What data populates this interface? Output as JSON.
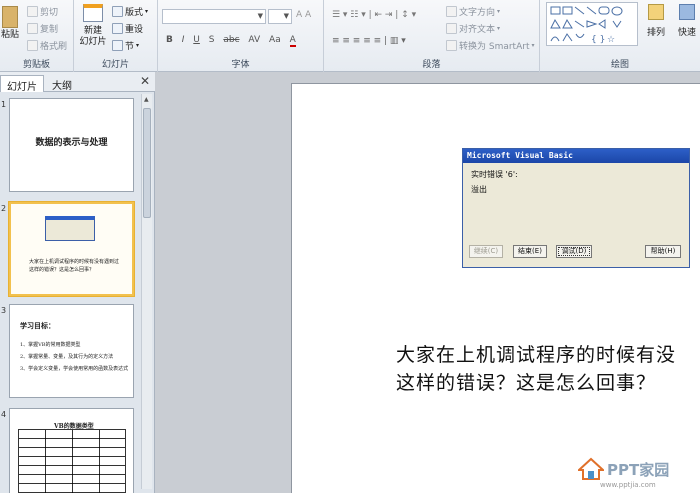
{
  "ribbon": {
    "clipboard": {
      "paste_label": "粘贴",
      "cut_label": "剪切",
      "copy_label": "复制",
      "format_painter_label": "格式刷",
      "group_label": "剪贴板"
    },
    "slides": {
      "new_slide_label": "新建",
      "new_slide_label2": "幻灯片",
      "layout_label": "版式",
      "reset_label": "重设",
      "section_label": "节",
      "group_label": "幻灯片"
    },
    "font": {
      "group_label": "字体",
      "format_buttons": [
        "B",
        "I",
        "U",
        "S",
        "abc",
        "AV",
        "Aa",
        "A"
      ]
    },
    "paragraph": {
      "text_direction_label": "文字方向",
      "align_text_label": "对齐文本",
      "smartart_label": "转换为 SmartArt",
      "group_label": "段落"
    },
    "drawing": {
      "arrange_label": "排列",
      "quick_styles_label": "快速",
      "group_label": "绘图"
    }
  },
  "left_pane": {
    "tab_slides": "幻灯片",
    "tab_outline": "大纲",
    "close_symbol": "✕",
    "thumbnails": [
      {
        "number": "1",
        "title": "数据的表示与处理"
      },
      {
        "number": "2",
        "line1": "大家在上机调试程序的时候有没有遇到过",
        "line2": "这样的错误？这是怎么回事？"
      },
      {
        "number": "3",
        "heading": "学习目标：",
        "items": [
          "1、掌握VB的常用数据类型",
          "2、掌握常量、变量，及其行为的定义方法",
          "3、学会定义变量，学会使用常用的函数及表达式"
        ]
      },
      {
        "number": "4",
        "table_title": "VB的数据类型"
      }
    ]
  },
  "slide": {
    "dialog": {
      "title": "Microsoft Visual Basic",
      "error_line": "实时错误 '6':",
      "message": "溢出",
      "buttons": [
        "继续(C)",
        "结束(E)",
        "调试(D)",
        "帮助(H)"
      ]
    },
    "body_line1": "大家在上机调试程序的时候有没",
    "body_line2": "这样的错误？这是怎么回事？"
  },
  "watermark": {
    "logo_text": "PPT家园",
    "url_text": "www.pptjia.com"
  },
  "colors": {
    "accent_selected": "#f2c14e",
    "dialog_title": "#2d5fc7"
  }
}
